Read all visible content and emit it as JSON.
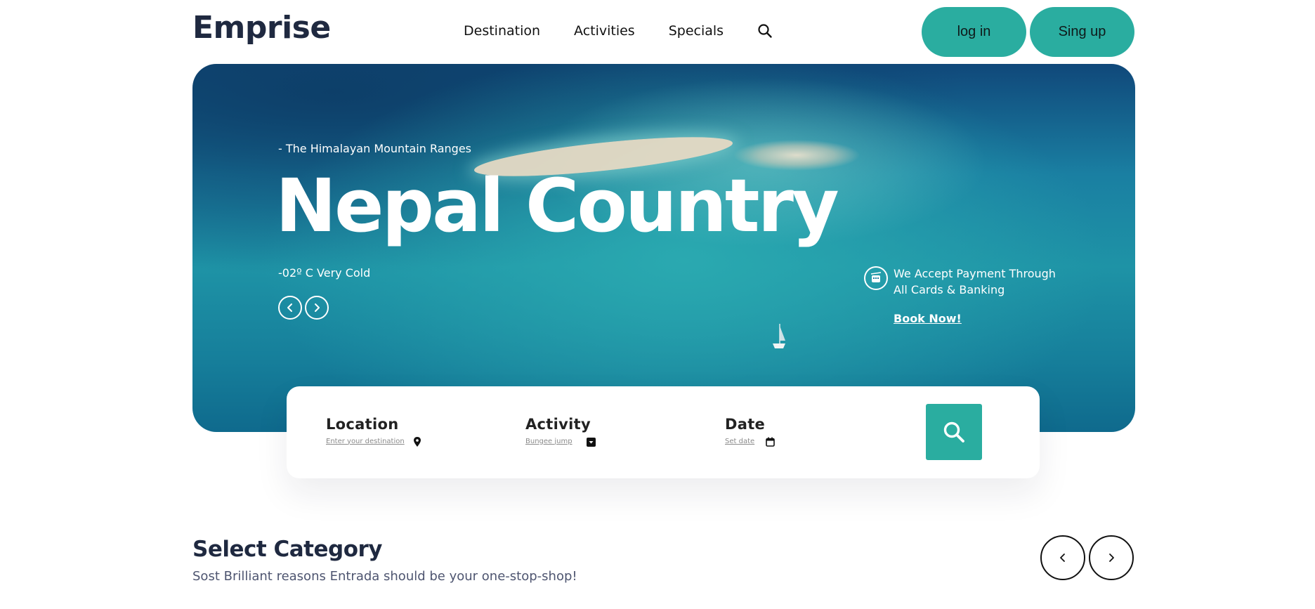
{
  "header": {
    "logo": "Emprise",
    "nav": [
      "Destination",
      "Activities",
      "Specials"
    ],
    "search_icon": "search-icon",
    "login_label": "log in",
    "signup_label": "Sing up"
  },
  "hero": {
    "subtitle": "- The Himalayan Mountain Ranges",
    "title": "Nepal Country",
    "temperature": "-02º C Very Cold",
    "payment_line1": "We Accept Payment Through",
    "payment_line2": "All Cards & Banking",
    "book_now": "Book Now!"
  },
  "search": {
    "location_label": "Location",
    "location_placeholder": "Enter your destination",
    "activity_label": "Activity",
    "activity_placeholder": "Bungee jump",
    "date_label": "Date",
    "date_placeholder": "Set date"
  },
  "category": {
    "title": "Select Category",
    "subtitle": "Sost Brilliant reasons Entrada should be your one-stop-shop!"
  },
  "colors": {
    "accent": "#2aada0",
    "heading": "#1f2940"
  }
}
